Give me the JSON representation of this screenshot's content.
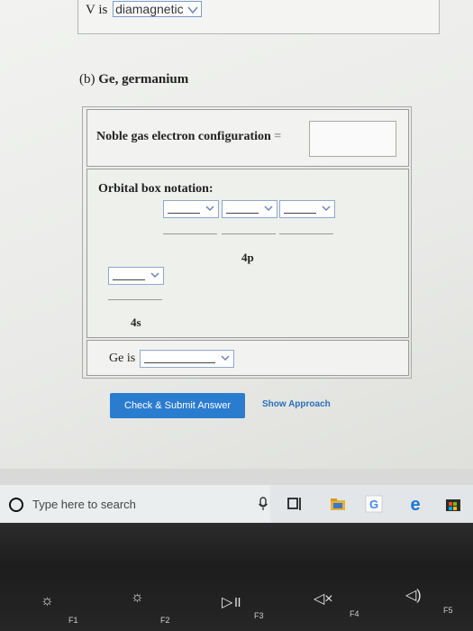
{
  "top_answer": {
    "letter": "V",
    "text": "is",
    "selected_value": "diamagnetic"
  },
  "part_b": {
    "part_letter": "(b)",
    "element_text": "Ge, germanium",
    "noble_gas_label": "Noble gas electron configuration",
    "equals": "=",
    "noble_gas_input_value": "",
    "orbital_label": "Orbital box notation:",
    "sublevel_4p": "4p",
    "sublevel_4s": "4s",
    "ge_is_label": "Ge is",
    "ge_is_value": ""
  },
  "actions": {
    "check_submit_label": "Check & Submit Answer",
    "show_approach_label": "Show Approach"
  },
  "taskbar": {
    "search_placeholder": "Type here to search",
    "icons": [
      "cortana-circle-icon",
      "microphone-icon",
      "task-view-icon",
      "file-explorer-icon",
      "chrome-icon",
      "edge-icon",
      "store-icon"
    ]
  },
  "keyboard": {
    "keys": [
      {
        "label": "F1",
        "icon": "brightness-down-icon"
      },
      {
        "label": "F2",
        "icon": "brightness-up-icon"
      },
      {
        "label": "F3",
        "icon": "play-pause-icon"
      },
      {
        "label": "F4",
        "icon": "mute-icon"
      },
      {
        "label": "F5",
        "icon": "volume-icon"
      }
    ]
  },
  "colors": {
    "button_blue": "#2a7ccf",
    "link_blue": "#2a6fb8",
    "dropdown_border": "#8fa8cc"
  }
}
